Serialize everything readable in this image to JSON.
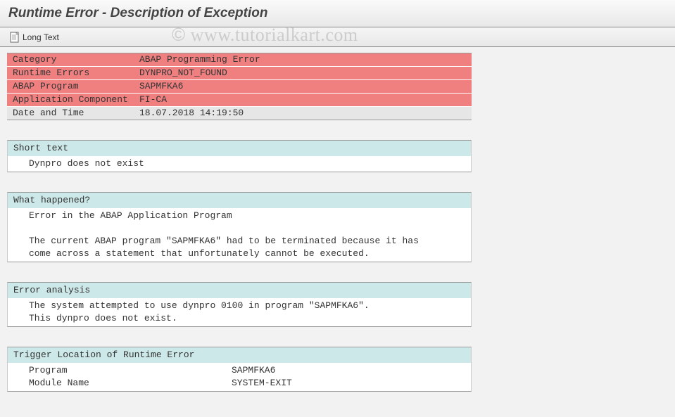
{
  "title": "Runtime Error - Description of Exception",
  "toolbar": {
    "long_text": "Long Text"
  },
  "headerRows": [
    {
      "label": "Category",
      "value": "ABAP Programming Error",
      "alt": false
    },
    {
      "label": "Runtime Errors",
      "value": "DYNPRO_NOT_FOUND",
      "alt": false
    },
    {
      "label": "ABAP Program",
      "value": "SAPMFKA6",
      "alt": false
    },
    {
      "label": "Application Component",
      "value": "FI-CA",
      "alt": false
    },
    {
      "label": "Date and Time",
      "value": "18.07.2018 14:19:50",
      "alt": true
    }
  ],
  "sections": {
    "short_text": {
      "title": "Short text",
      "body": "Dynpro does not exist"
    },
    "what_happened": {
      "title": "What happened?",
      "line1": "Error in the ABAP Application Program",
      "line2": "",
      "line3": "The current ABAP program \"SAPMFKA6\" had to be terminated because it has",
      "line4": "come across a statement that unfortunately cannot be executed."
    },
    "error_analysis": {
      "title": "Error analysis",
      "line1": "The system attempted to use dynpro 0100 in program \"SAPMFKA6\".",
      "line2": "This dynpro does not exist."
    },
    "trigger": {
      "title": "Trigger Location of Runtime Error",
      "program_label": "Program",
      "program_value": "SAPMFKA6",
      "module_label": "Module Name",
      "module_value": "SYSTEM-EXIT"
    }
  },
  "watermark": {
    "symbol": "©",
    "text": "www.tutorialkart.com"
  }
}
